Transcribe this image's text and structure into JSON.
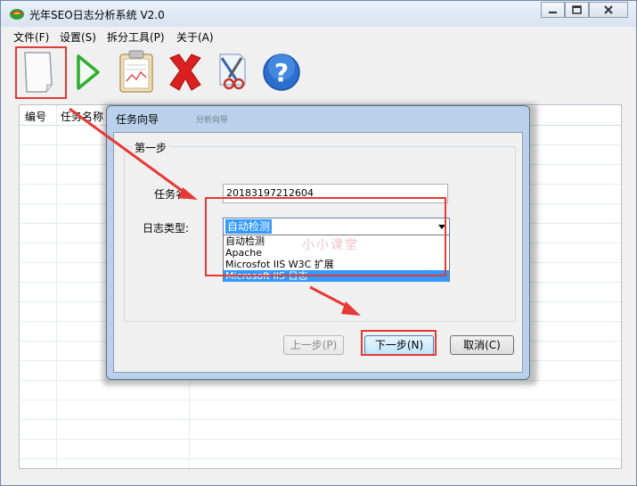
{
  "window": {
    "title": "光年SEO日志分析系统 V2.0",
    "minimize_icon": "minimize-icon",
    "maximize_icon": "maximize-icon",
    "close_icon": "close-icon"
  },
  "menu": {
    "items": [
      "文件(F)",
      "设置(S)",
      "拆分工具(P)",
      "关于(A)"
    ]
  },
  "toolbar": {
    "tools": [
      {
        "name": "new-task",
        "icon": "blank-page-icon"
      },
      {
        "name": "run",
        "icon": "green-play-icon"
      },
      {
        "name": "report",
        "icon": "clipboard-chart-icon"
      },
      {
        "name": "delete",
        "icon": "red-x-icon"
      },
      {
        "name": "split",
        "icon": "scissors-icon"
      },
      {
        "name": "help",
        "icon": "question-icon"
      }
    ]
  },
  "grid": {
    "columns": [
      "编号",
      "任务名称"
    ]
  },
  "dialog": {
    "title": "任务向导",
    "title_faint": "分析向导",
    "group_label": "第一步",
    "task_name_label": "任务名:",
    "task_name_value": "20183197212604",
    "log_type_label": "日志类型:",
    "log_type_selected": "自动检测",
    "log_type_options": [
      "自动检测",
      "Apache",
      "Microsfot IIS W3C 扩展",
      "Microsoft IIS 日志"
    ],
    "highlighted_option_index": 3,
    "prev_button": "上一步(P)",
    "next_button": "下一步(N)",
    "cancel_button": "取消(C)"
  },
  "watermark": "小小课堂",
  "colors": {
    "highlight_red": "#e53935",
    "selection_blue": "#3399ff",
    "dialog_frame": "#b9d1ea"
  }
}
